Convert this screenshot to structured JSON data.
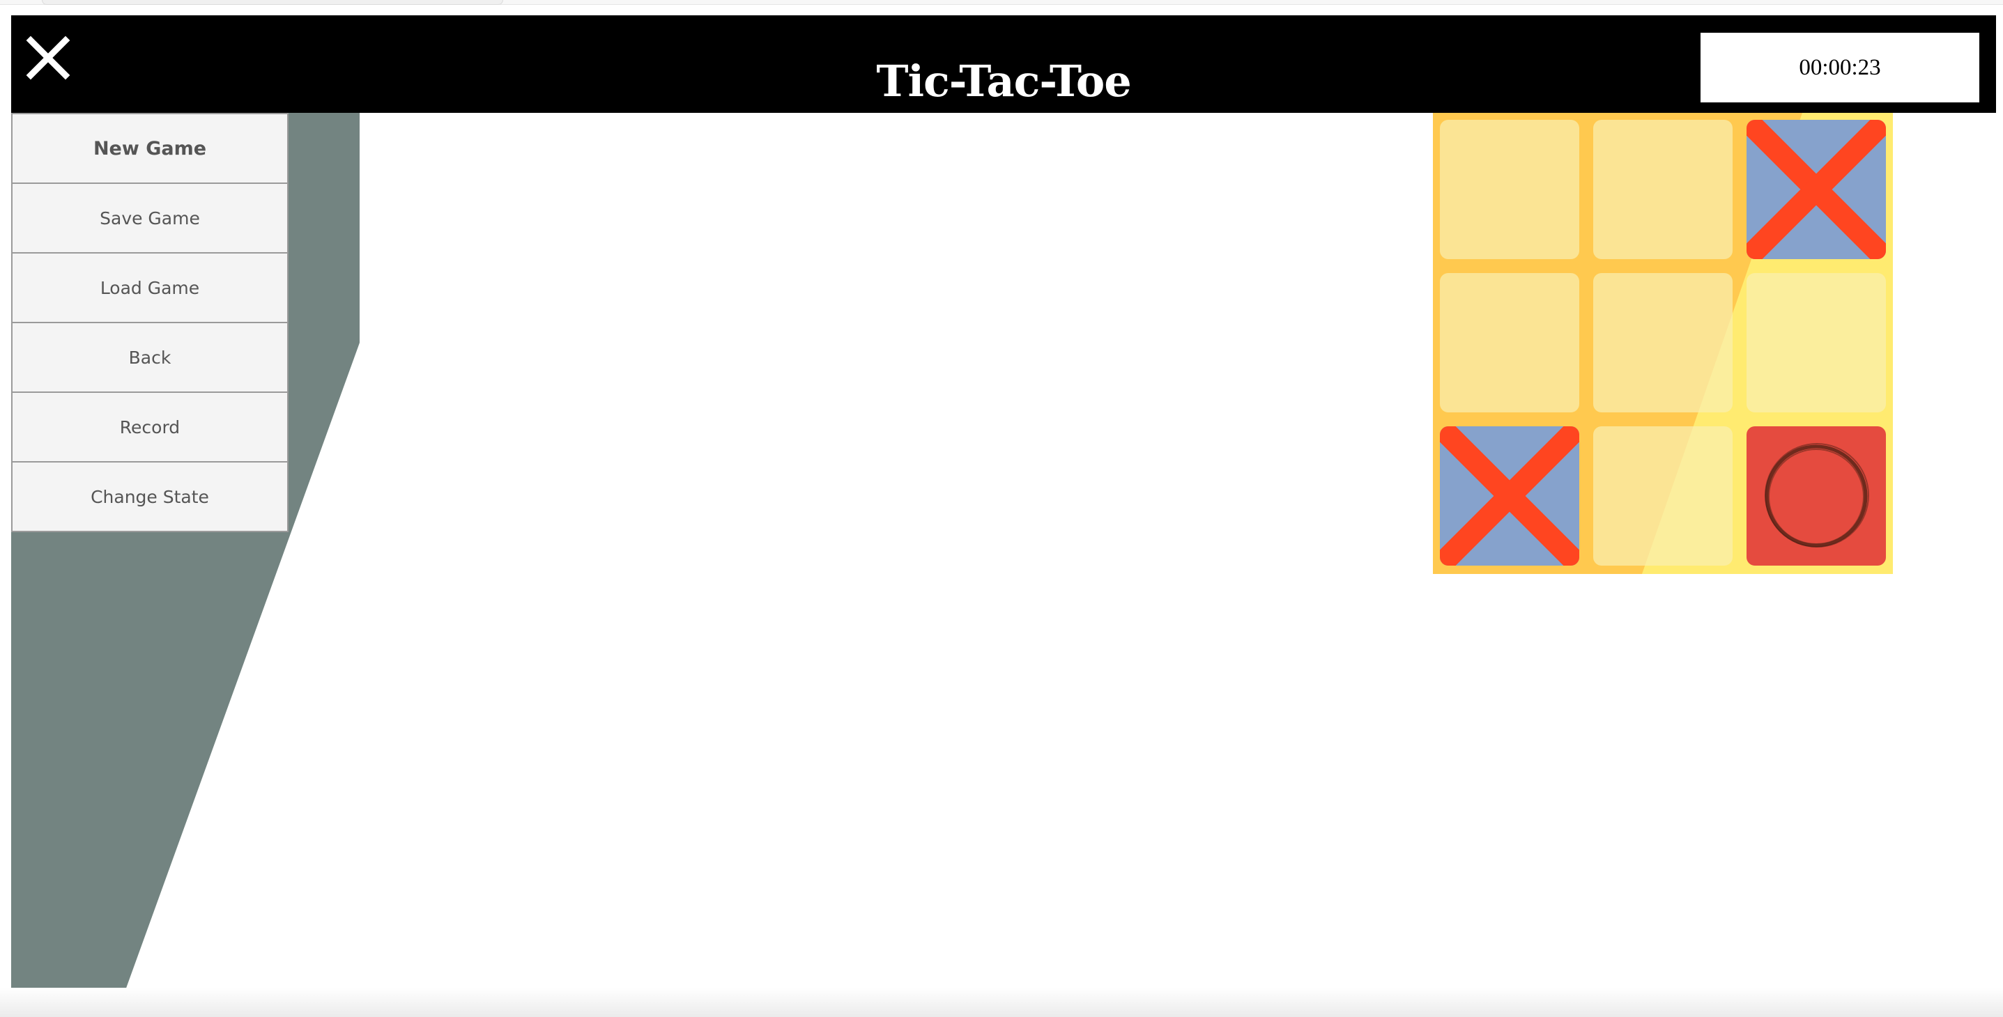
{
  "header": {
    "title": "Tic-Tac-Toe",
    "timer": "00:00:23",
    "close_icon": "close-icon"
  },
  "menu": {
    "items": [
      {
        "label": "New Game"
      },
      {
        "label": "Save Game"
      },
      {
        "label": "Load Game"
      },
      {
        "label": "Back"
      },
      {
        "label": "Record"
      },
      {
        "label": "Change State"
      }
    ]
  },
  "board": {
    "cells": [
      "",
      "",
      "X",
      "",
      "",
      "",
      "X",
      "",
      "O"
    ]
  },
  "colors": {
    "header_bg": "#000000",
    "sidebar": "#738481",
    "board_bg": "#ffc94f",
    "x_cell": "#86a2cc",
    "x_mark": "#ff4520",
    "o_cell": "#e54b3f"
  }
}
